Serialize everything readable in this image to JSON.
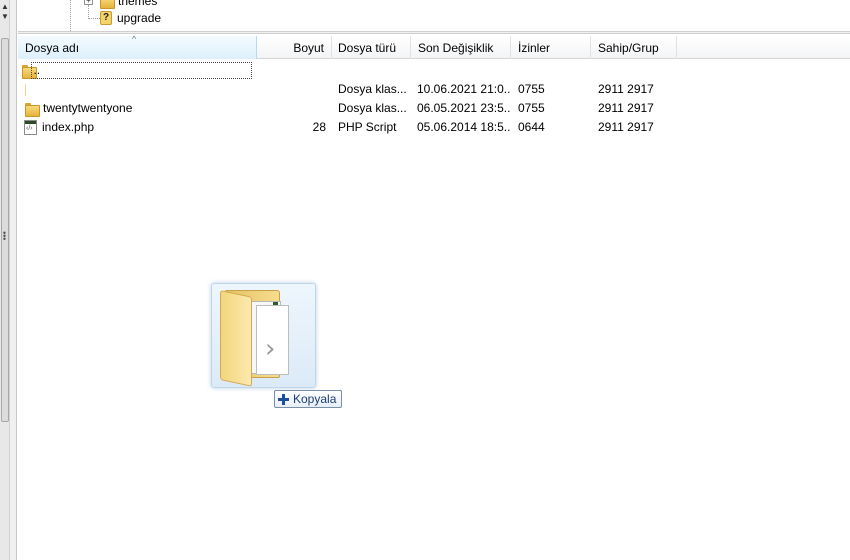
{
  "tree": {
    "items": [
      {
        "label": "themes",
        "icon": "folder-icon"
      },
      {
        "label": "upgrade",
        "icon": "question-icon"
      }
    ]
  },
  "file_list": {
    "columns": [
      "Dosya adı",
      "Boyut",
      "Dosya türü",
      "Son Değişiklik",
      "İzinler",
      "Sahip/Grup"
    ],
    "rows": [
      {
        "name": "..",
        "size": "",
        "type": "",
        "modified": "",
        "permissions": "",
        "owner": "",
        "icon": "folder-icon"
      },
      {
        "name": "",
        "size": "",
        "type": "Dosya klas...",
        "modified": "10.06.2021 21:0...",
        "permissions": "0755",
        "owner": "2911 2917",
        "icon": ""
      },
      {
        "name": "twentytwentyone",
        "size": "",
        "type": "Dosya klas...",
        "modified": "06.05.2021 23:5...",
        "permissions": "0755",
        "owner": "2911 2917",
        "icon": "folder-icon"
      },
      {
        "name": "index.php",
        "size": "28",
        "type": "PHP Script",
        "modified": "05.06.2014 18:5...",
        "permissions": "0644",
        "owner": "2911 2917",
        "icon": "php-file-icon"
      }
    ]
  },
  "drag": {
    "tooltip_label": "Kopyala"
  },
  "colors": {
    "selected_header": "#dcf0fb",
    "folder": "#e6b33c",
    "tooltip_text": "#1b3d72"
  }
}
